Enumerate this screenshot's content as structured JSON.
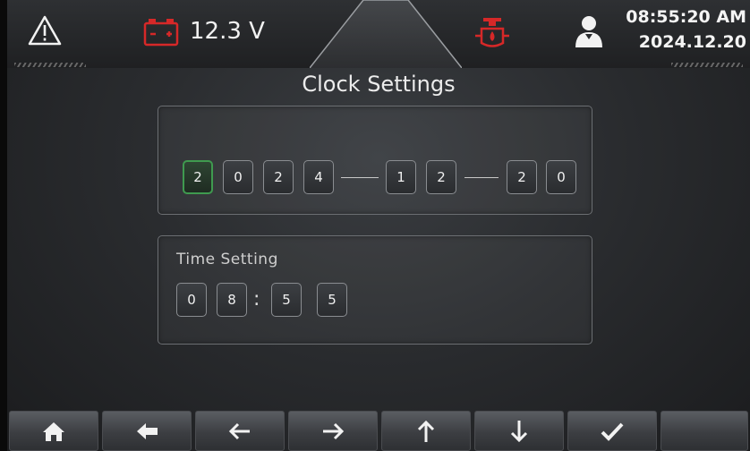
{
  "status": {
    "voltage": "12.3 V",
    "time": "08:55:20 AM",
    "date": "2024.12.20",
    "icons": [
      "warning-icon",
      "battery-icon",
      "engine-oil-icon",
      "user-icon"
    ],
    "colors": {
      "alert_red": "#d62828",
      "active_green": "#3f9a4f"
    }
  },
  "page": {
    "title": "Clock Settings"
  },
  "date_setting": {
    "digits": [
      "2",
      "0",
      "2",
      "4",
      "1",
      "2",
      "2",
      "0"
    ],
    "active_index": 0
  },
  "time_setting": {
    "label": "Time Setting",
    "digits": [
      "0",
      "8",
      "5",
      "5"
    ],
    "separator": ":"
  },
  "nav": {
    "buttons": [
      "home-icon",
      "back-icon",
      "left-arrow-icon",
      "right-arrow-icon",
      "up-arrow-icon",
      "down-arrow-icon",
      "check-icon",
      "blank"
    ]
  }
}
